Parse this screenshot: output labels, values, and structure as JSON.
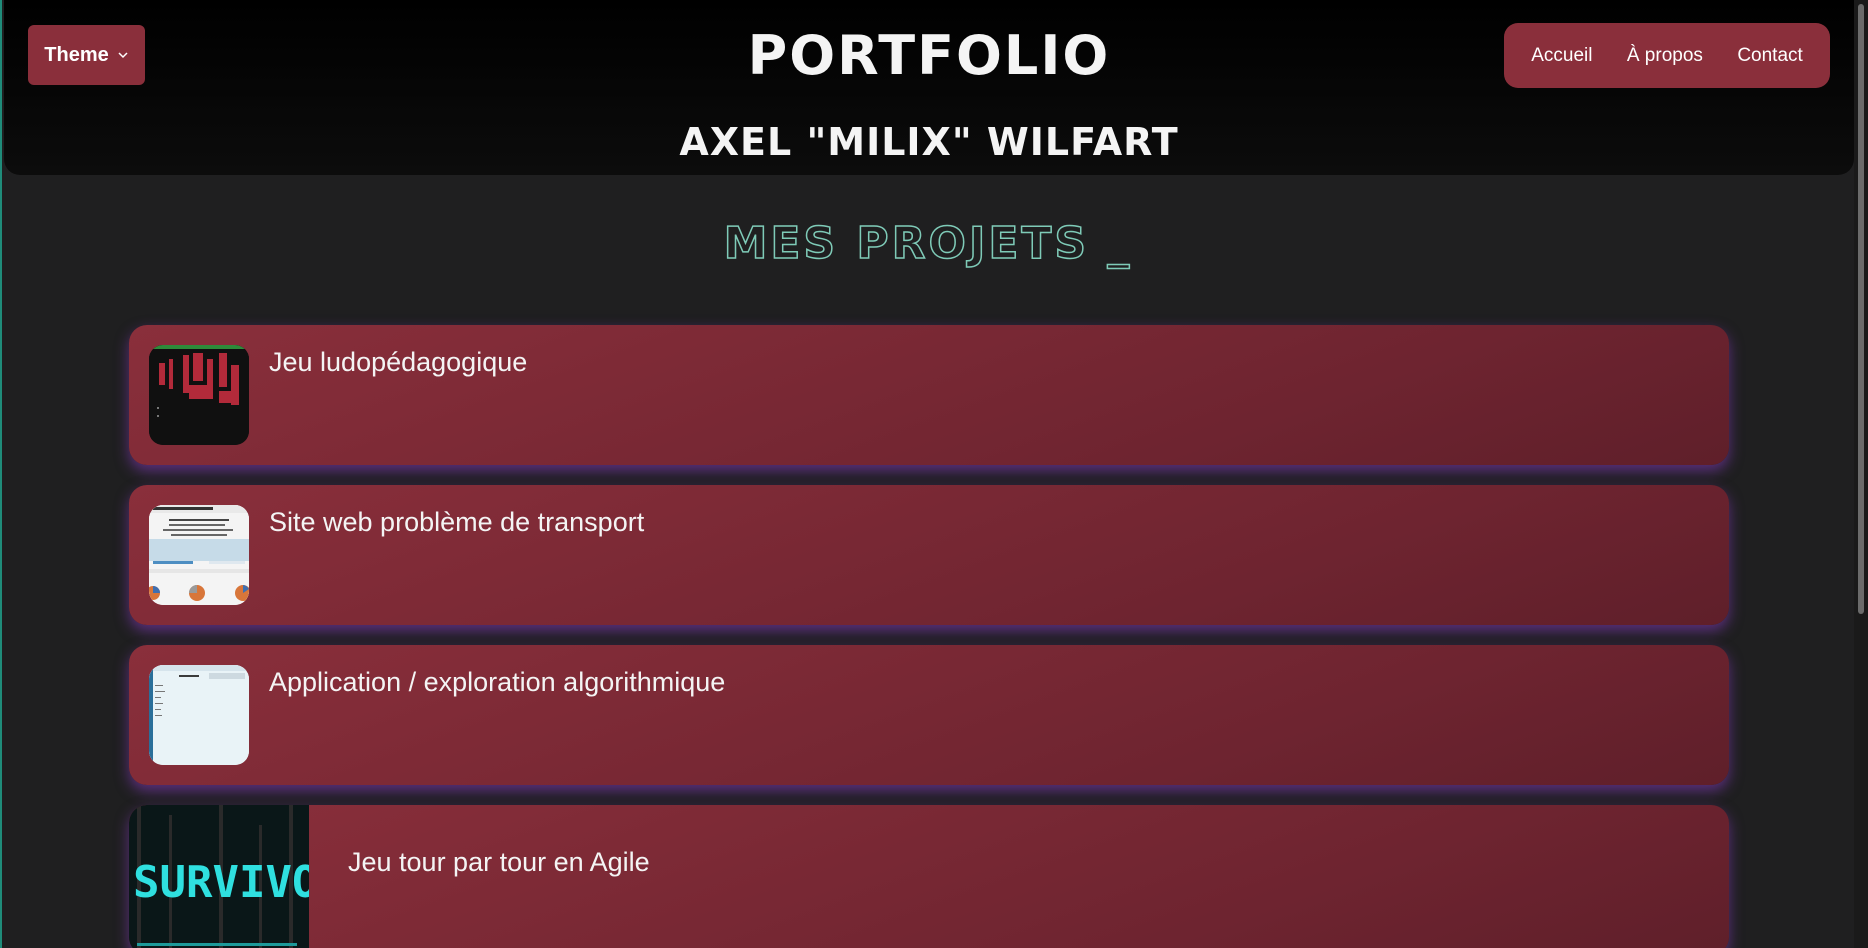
{
  "header": {
    "theme_label": "Theme",
    "brand": "PORTFOLIO",
    "author": "AXEL \"MILIX\" WILFART",
    "nav": [
      {
        "label": "Accueil"
      },
      {
        "label": "À propos"
      },
      {
        "label": "Contact"
      }
    ]
  },
  "section": {
    "title": "MES PROJETS _"
  },
  "projects": [
    {
      "title": "Jeu ludopédagogique",
      "thumb_icon": "game-screenshot"
    },
    {
      "title": "Site web problème de transport",
      "thumb_icon": "website-screenshot"
    },
    {
      "title": "Application / exploration algorithmique",
      "thumb_icon": "app-screenshot"
    },
    {
      "title": "Jeu tour par tour en Agile",
      "thumb_icon": "survivor-game-screenshot",
      "thumb_text": "SURVIVOR"
    }
  ],
  "colors": {
    "accent": "#8a2f3b",
    "background": "#1f1f20",
    "header": "#000000",
    "glow": "#8c3cc8",
    "title_outline": "#7ecbb8"
  }
}
